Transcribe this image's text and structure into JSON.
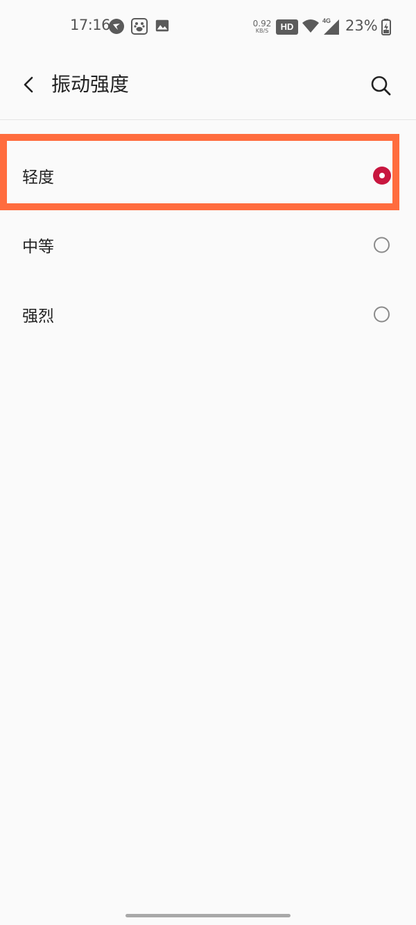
{
  "status_bar": {
    "time": "17:16",
    "net_speed_value": "0.92",
    "net_speed_unit": "KB/S",
    "hd_badge": "HD",
    "network_type": "4G",
    "battery_percent": "23%",
    "icons": [
      "bird-notification-icon",
      "baidu-paw-icon",
      "image-notification-icon",
      "wifi-icon",
      "cellular-signal-icon",
      "battery-charging-icon"
    ]
  },
  "header": {
    "title": "振动强度",
    "back_icon": "chevron-left-icon",
    "search_icon": "search-icon"
  },
  "options": [
    {
      "label": "轻度",
      "selected": true
    },
    {
      "label": "中等",
      "selected": false
    },
    {
      "label": "强烈",
      "selected": false
    }
  ],
  "colors": {
    "background": "#fafafa",
    "accent": "#c8163f",
    "highlight": "#ff6c3e"
  }
}
